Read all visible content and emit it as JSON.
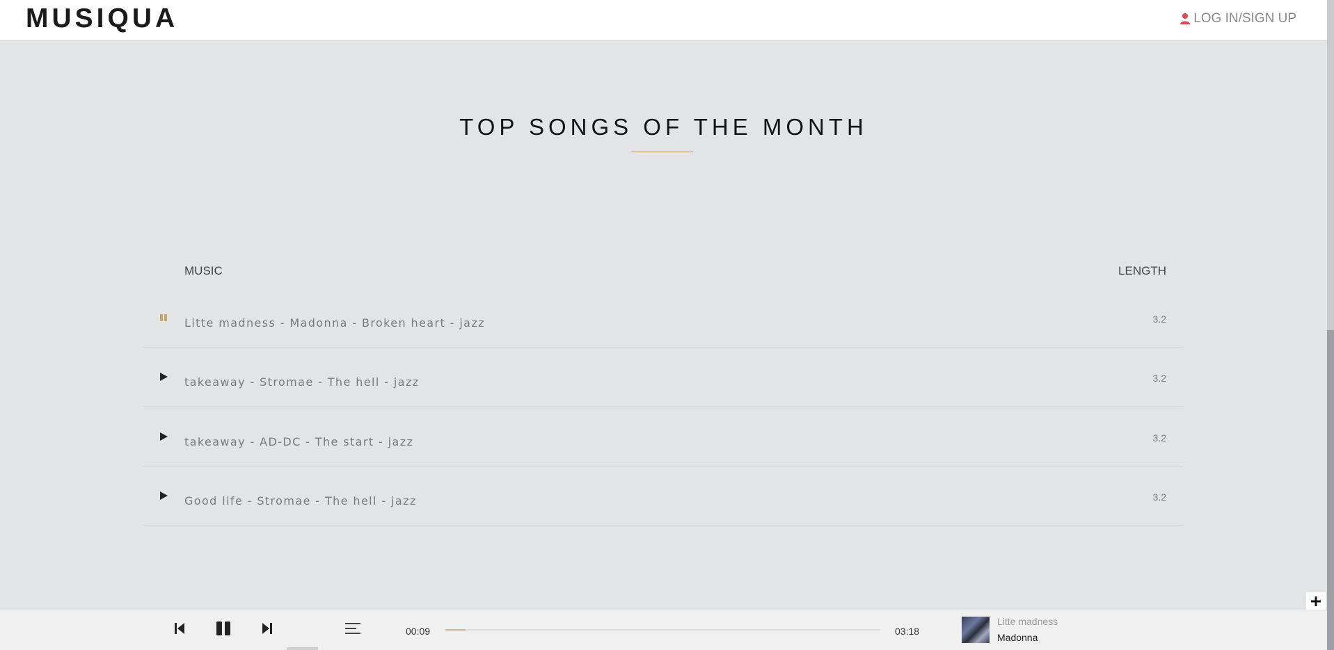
{
  "header": {
    "logo": "MUSIQUA",
    "login_label": "LOG IN/SIGN UP"
  },
  "section": {
    "title": "TOP SONGS OF THE MONTH"
  },
  "table": {
    "columns": [
      "MUSIC",
      "LENGTH"
    ],
    "rows": [
      {
        "song": "Litte madness - Madonna - Broken heart - jazz",
        "length": "3.2",
        "state": "playing"
      },
      {
        "song": "takeaway - Stromae - The hell - jazz",
        "length": "3.2",
        "state": "paused"
      },
      {
        "song": "takeaway - AD-DC - The start - jazz",
        "length": "3.2",
        "state": "paused"
      },
      {
        "song": "Good life - Stromae - The hell - jazz",
        "length": "3.2",
        "state": "paused"
      }
    ]
  },
  "player": {
    "current_time": "00:09",
    "total_time": "03:18",
    "progress_fraction": 0.047,
    "now_playing_title": "Litte madness",
    "now_playing_artist": "Madonna"
  },
  "colors": {
    "accent": "#b59a66",
    "login_icon": "#e0484d"
  },
  "icons": {
    "login": "user-icon",
    "playing_row": "pause-icon",
    "idle_row": "play-icon",
    "prev": "skip-previous-icon",
    "pause": "pause-icon",
    "next": "skip-next-icon",
    "playlist": "playlist-icon",
    "zoom_in": "plus-icon",
    "zoom_out": "minus-icon"
  }
}
